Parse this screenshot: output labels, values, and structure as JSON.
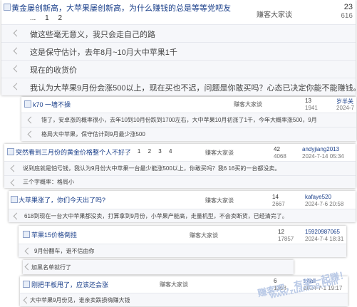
{
  "threads": [
    {
      "title": "黄金屡创新高，大苹果屡创新高，为什么赚钱的总是等等党吧友",
      "pager": [
        "...",
        "1",
        "2"
      ],
      "author": "赚客大家谈",
      "replies": "23",
      "views": "616",
      "reply_lines": [
        "做这些毫无意义，我只会走自己的路",
        "这是保守估计，去年8月~10月大中苹果1千",
        "现在的收货价",
        "我认为大苹果9月份会涨500以上，现在买也不迟，问题是你敢买吗？心态已决定你能不能赚钱。"
      ]
    },
    {
      "title": "k70 一墙不操",
      "author": "赚客大家谈",
      "replies": "13",
      "views": "1941",
      "poster": "岁半关",
      "date": "2024-7",
      "reply_lines": [
        "错了，安卓涨的概率很小，去年10到10月份跌到1700左右，大中苹果10月初涨了1千，今年大概率涨500，9月",
        "格局大中苹果，保守估计到9月最少涨500"
      ]
    },
    {
      "title": "突然看到三月份的黄金价格整个人不好了",
      "pager": [
        "...",
        "1",
        "2",
        "3",
        "4"
      ],
      "author": "赚客大家谈",
      "replies": "42",
      "views": "4068",
      "poster": "andyjiang2013",
      "date": "2024-7-14 05:34",
      "reply_lines": [
        "说到底就是怕亏钱，我认为9月份大中苹果一台最少能涨500以上，你敢买吗？我6 16买的一台都没卖。",
        "三个字概率：格局小"
      ]
    },
    {
      "title": "大苹果涨了，你们今天出了吗?",
      "author": "赚客大家谈",
      "replies": "14",
      "views": "2667",
      "poster": "kafaye520",
      "date": "2024-7-6 20:58",
      "reply_lines": [
        "618到现在一台大中苹果都没卖，打算拿到9月份，小苹果产能高，走量机型，不会卖断货，已经清完了。"
      ]
    },
    {
      "title": "苹果15价格倒挂",
      "author": "赚客大家谈",
      "replies": "12",
      "views": "17857",
      "poster": "15920987065",
      "date": "2024-7-4 18:31",
      "reply_lines": [
        "9月份翻车，谁不信由你"
      ]
    },
    {
      "title": "",
      "author": "",
      "reply_lines": [
        "加黑名单就行了"
      ]
    },
    {
      "title": "刚把平板甩了，应该还会涨",
      "author": "赚客大家谈",
      "replies": "6",
      "views": "1368",
      "poster": "tmall",
      "date": "2024-7-1 19:17",
      "reply_lines": [
        "大中苹果9月份见，谁亲卖跌损嗨赚大钱"
      ]
    }
  ],
  "watermark": {
    "line1": "赚客吧，有奖一起赚！",
    "line2": "www.zuanke8.com"
  }
}
